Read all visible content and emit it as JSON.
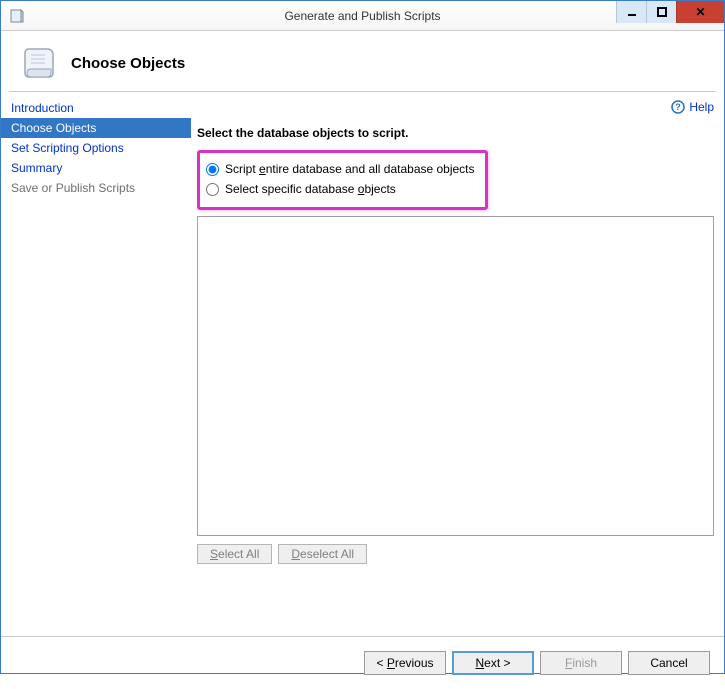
{
  "titlebar": {
    "title": "Generate and Publish Scripts"
  },
  "header": {
    "page_title": "Choose Objects"
  },
  "sidebar": {
    "items": [
      {
        "label": "Introduction",
        "state": "link"
      },
      {
        "label": "Choose Objects",
        "state": "active"
      },
      {
        "label": "Set Scripting Options",
        "state": "link"
      },
      {
        "label": "Summary",
        "state": "link"
      },
      {
        "label": "Save or Publish Scripts",
        "state": "disabled"
      }
    ]
  },
  "content": {
    "help_label": "Help",
    "instruction": "Select the database objects to script.",
    "radio_entire_pre": "Script ",
    "radio_entire_access": "e",
    "radio_entire_post": "ntire database and all database objects",
    "radio_specific_pre": "Select specific database ",
    "radio_specific_access": "o",
    "radio_specific_post": "bjects",
    "radio_selected": "entire",
    "select_all_pre": "",
    "select_all_access": "S",
    "select_all_post": "elect All",
    "deselect_all_pre": "",
    "deselect_all_access": "D",
    "deselect_all_post": "eselect All"
  },
  "footer": {
    "previous_pre": "< ",
    "previous_access": "P",
    "previous_post": "revious",
    "next_pre": "",
    "next_access": "N",
    "next_post": "ext >",
    "finish_pre": "",
    "finish_access": "F",
    "finish_post": "inish",
    "cancel": "Cancel"
  }
}
